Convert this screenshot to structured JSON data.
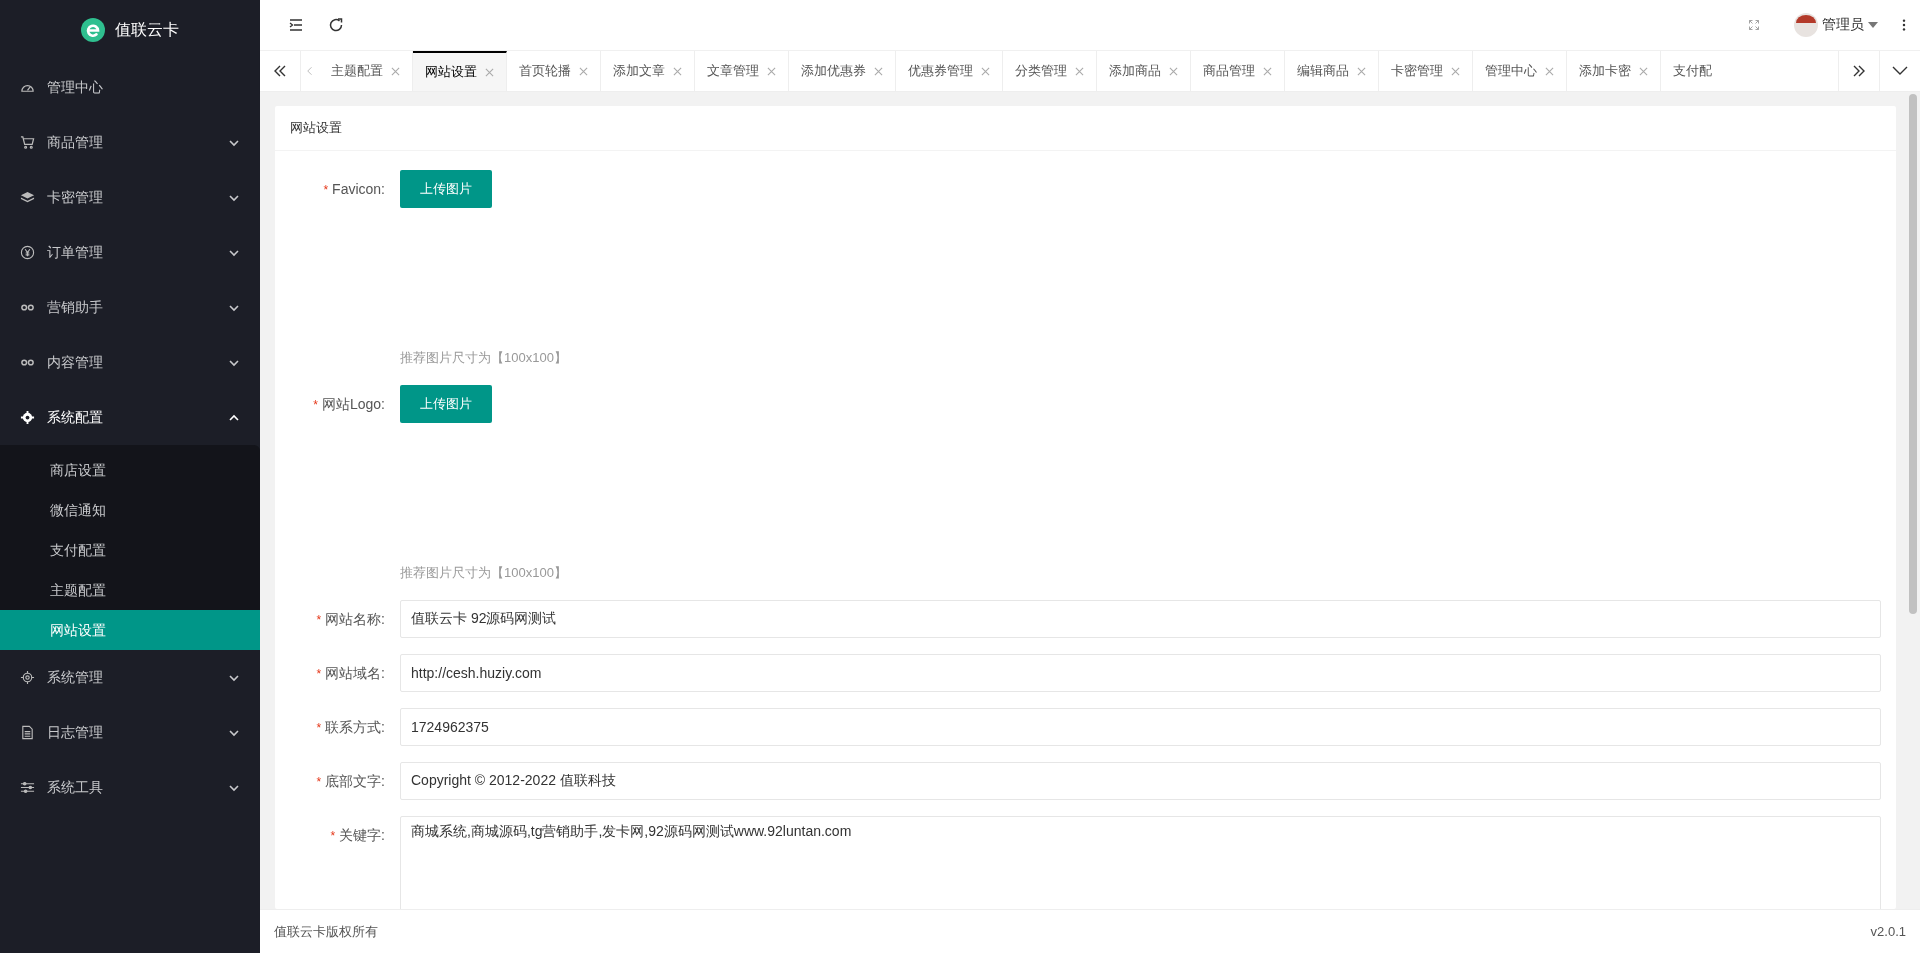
{
  "brand": {
    "name": "值联云卡"
  },
  "sidebar": {
    "items": [
      {
        "label": "管理中心"
      },
      {
        "label": "商品管理",
        "expanded": false
      },
      {
        "label": "卡密管理",
        "expanded": false
      },
      {
        "label": "订单管理",
        "expanded": false
      },
      {
        "label": "营销助手",
        "expanded": false
      },
      {
        "label": "内容管理",
        "expanded": false
      },
      {
        "label": "系统配置",
        "expanded": true,
        "children": [
          {
            "label": "商店设置",
            "selected": false
          },
          {
            "label": "微信通知",
            "selected": false
          },
          {
            "label": "支付配置",
            "selected": false
          },
          {
            "label": "主题配置",
            "selected": false
          },
          {
            "label": "网站设置",
            "selected": true
          }
        ]
      },
      {
        "label": "系统管理",
        "expanded": false
      },
      {
        "label": "日志管理",
        "expanded": false
      },
      {
        "label": "系统工具",
        "expanded": false
      }
    ]
  },
  "header": {
    "user": "管理员"
  },
  "tabs": [
    {
      "label": "主题配置",
      "selected": false
    },
    {
      "label": "网站设置",
      "selected": true
    },
    {
      "label": "首页轮播",
      "selected": false
    },
    {
      "label": "添加文章",
      "selected": false
    },
    {
      "label": "文章管理",
      "selected": false
    },
    {
      "label": "添加优惠券",
      "selected": false
    },
    {
      "label": "优惠券管理",
      "selected": false
    },
    {
      "label": "分类管理",
      "selected": false
    },
    {
      "label": "添加商品",
      "selected": false
    },
    {
      "label": "商品管理",
      "selected": false
    },
    {
      "label": "编辑商品",
      "selected": false
    },
    {
      "label": "卡密管理",
      "selected": false
    },
    {
      "label": "管理中心",
      "selected": false
    },
    {
      "label": "添加卡密",
      "selected": false
    },
    {
      "label": "支付配",
      "selected": false
    }
  ],
  "card": {
    "title": "网站设置",
    "fields": [
      {
        "kind": "upload",
        "label": "Favicon:",
        "required_mark": "*",
        "button": "上传图片",
        "hint": "推荐图片尺寸为【100x100】"
      },
      {
        "kind": "upload",
        "label": "网站Logo:",
        "required_mark": "*",
        "button": "上传图片",
        "hint": "推荐图片尺寸为【100x100】"
      },
      {
        "kind": "input",
        "label": "网站名称:",
        "required_mark": "*",
        "value": "值联云卡 92源码网测试"
      },
      {
        "kind": "input",
        "label": "网站域名:",
        "required_mark": "*",
        "value": "http://cesh.huziy.com"
      },
      {
        "kind": "input",
        "label": "联系方式:",
        "required_mark": "*",
        "value": "1724962375"
      },
      {
        "kind": "input",
        "label": "底部文字:",
        "required_mark": "*",
        "value": "Copyright © 2012-2022 值联科技"
      },
      {
        "kind": "textarea",
        "label": "关键字:",
        "required_mark": "*",
        "value": "商城系统,商城源码,tg营销助手,发卡网,92源码网测试www.92luntan.com"
      }
    ]
  },
  "footer": {
    "copyright": "值联云卡版权所有",
    "version": "v2.0.1"
  }
}
